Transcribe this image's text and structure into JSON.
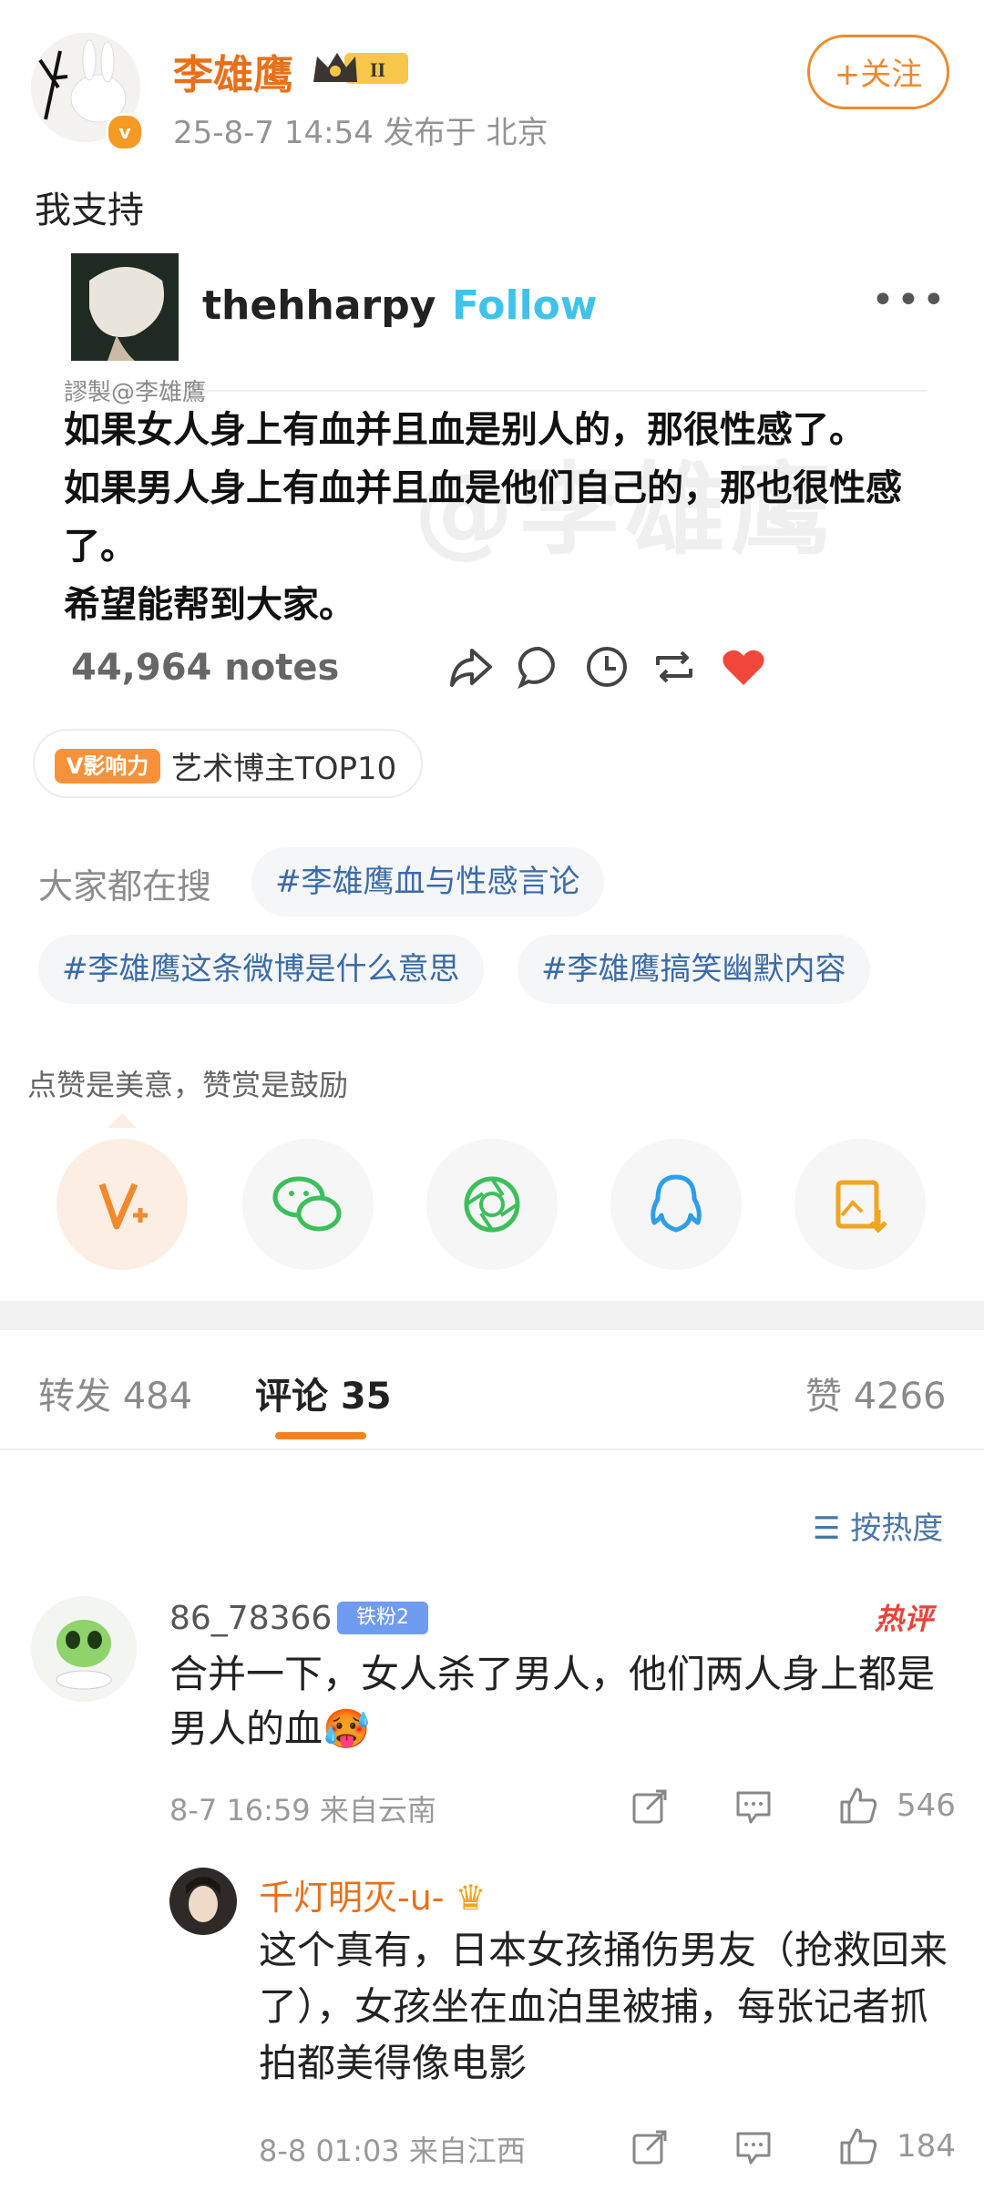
{
  "post": {
    "author": "李雄鹰",
    "verified_icon": "v-badge",
    "crown_label": "II",
    "meta": "25-8-7 14:54  发布于 北京",
    "follow_label": "+关注",
    "text": "我支持"
  },
  "card": {
    "account": "thehharpy",
    "follow": "Follow",
    "more": "•••",
    "watermark_small": "謬製@李雄鷹",
    "watermark_big": "@李雄鹰",
    "lines": [
      "如果女人身上有血并且血是别人的，那很性感了。",
      "如果男人身上有血并且血是他们自己的，那也很性感了。",
      "希望能帮到大家。"
    ],
    "notes": "44,964 notes",
    "heart_color": "#f0473a"
  },
  "tag": {
    "badge": "V影响力",
    "label": "艺术博主TOP10"
  },
  "search": {
    "label": "大家都在搜",
    "pills": [
      "#李雄鹰血与性感言论",
      "#李雄鹰这条微博是什么意思",
      "#李雄鹰搞笑幽默内容"
    ]
  },
  "share": {
    "hint": "点赞是美意，赞赏是鼓励",
    "buttons": [
      "v-plus-icon",
      "wechat-icon",
      "moments-icon",
      "qq-icon",
      "save-image-icon"
    ]
  },
  "tabs": {
    "repost": "转发 484",
    "comments": "评论 35",
    "likes": "赞 4266",
    "sort": "按热度"
  },
  "comments": [
    {
      "user": "86_78366",
      "badge": "铁粉2",
      "hot": "热评",
      "text": "合并一下，女人杀了男人，他们两人身上都是男人的血🥵",
      "meta": "8-7 16:59  来自云南",
      "likes": "546"
    },
    {
      "user": "千灯明灭-u-",
      "text": "这个真有，日本女孩捅伤男友（抢救回来了），女孩坐在血泊里被捕，每张记者抓拍都美得像电影",
      "meta": "8-8 01:03  来自江西",
      "likes": "184"
    }
  ]
}
